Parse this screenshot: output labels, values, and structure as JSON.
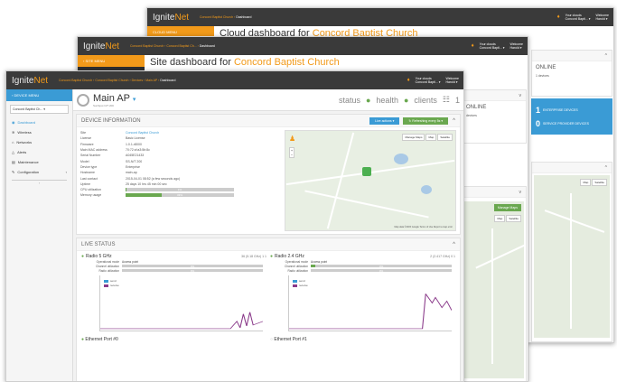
{
  "brand": {
    "name_prefix": "Ignite",
    "name_suffix": "Net"
  },
  "cloud_window": {
    "breadcrumb_link": "Concord Baptist Church",
    "breadcrumb_current": "Dashboard",
    "menu_title": "CLOUD MENU",
    "page_title_prefix": "Cloud dashboard for",
    "page_title_org": "Concord Baptist Church",
    "user_org_label": "Your clouds",
    "user_org": "Concord Bapti...",
    "welcome_label": "Welcome",
    "user_name": "Harold",
    "online_title": "ONLINE",
    "online_count": "1 devices",
    "enterprise_label": "ENTERPRISE DEVICES",
    "enterprise_count": "1",
    "service_label": "SERVICE PROVIDER DEVICES",
    "service_count": "0"
  },
  "site_window": {
    "breadcrumb_link": "Concord Baptist Church",
    "breadcrumb_mid": "Concord Baptist Ch...",
    "breadcrumb_current": "Dashboard",
    "menu_title": "SITE MENU",
    "page_title_prefix": "Site dashboard for",
    "page_title_org": "Concord Baptist Church",
    "online_title": "ONLINE",
    "online_sub": "devices",
    "manage_maps": "Manage Maps",
    "map_btn": "Map",
    "satellite_btn": "Satellite"
  },
  "device_window": {
    "breadcrumb": [
      "Concord Baptist Church",
      "Concord Baptist Church",
      "Devices",
      "Main AP",
      "Dashboard"
    ],
    "menu_title": "DEVICE MENU",
    "site_select": "Concord Baptist Ch...",
    "nav": [
      {
        "icon": "dashboard-icon",
        "glyph": "◉",
        "label": "Dashboard"
      },
      {
        "icon": "wireless-icon",
        "glyph": "≋",
        "label": "Wireless"
      },
      {
        "icon": "networks-icon",
        "glyph": "⌂",
        "label": "Networks"
      },
      {
        "icon": "alerts-icon",
        "glyph": "△",
        "label": "Alerts"
      },
      {
        "icon": "maintenance-icon",
        "glyph": "▤",
        "label": "Maintenance"
      },
      {
        "icon": "configuration-icon",
        "glyph": "✎",
        "label": "Configuration"
      }
    ],
    "device_name": "Main AP",
    "device_model": "SunSpot N/T 200",
    "status_label": "status",
    "health_label": "health",
    "clients_label": "clients",
    "clients_count": "1",
    "info_title": "DEVICE INFORMATION",
    "live_actions": "Live actions",
    "refreshing": "Refreshing every 5s",
    "info": [
      {
        "k": "Site",
        "v": "Concord Baptist Church",
        "link": true
      },
      {
        "k": "License",
        "v": "Basic License"
      },
      {
        "k": "Firmware",
        "v": "1.0.1-r8000"
      },
      {
        "k": "Main MAC address",
        "v": "70:72:cf:a3:5b:8c"
      },
      {
        "k": "Serial Number",
        "v": "A045E21433"
      },
      {
        "k": "Model",
        "v": "SS-N/T 200"
      },
      {
        "k": "Device type",
        "v": "Enterprise"
      },
      {
        "k": "Hostname",
        "v": "main-ap"
      },
      {
        "k": "Last contact",
        "v": "2015-04-01 08:52 (a few seconds ago)"
      },
      {
        "k": "Uptime",
        "v": "25 days 10 hrs 45 min 00 sec"
      }
    ],
    "cpu_label": "CPU utilization",
    "cpu_value": "1%",
    "cpu_percent": 1,
    "memory_label": "Memory usage",
    "memory_value": "33%",
    "memory_percent": 33,
    "map_manage": "Manage Maps",
    "map_btn": "Map",
    "satellite_btn": "Satellite",
    "map_footer": "Map data ©2015 Google   Terms of Use   Report a map error",
    "live_title": "LIVE STATUS",
    "radios": [
      {
        "name": "Radio 5 GHz",
        "meta": "36 (5.18 GHz)  1  1",
        "mode_label": "Operational mode",
        "mode": "Access point",
        "channel_label": "Channel utilization",
        "channel_value": "0%",
        "channel_percent": 0,
        "radio_label": "Radio utilization",
        "radio_value": "0%",
        "radio_percent": 0,
        "legend_send": "send",
        "legend_receive": "receive"
      },
      {
        "name": "Radio 2.4 GHz",
        "meta": "2 (2.417 GHz)  0  1",
        "mode_label": "Operational mode",
        "mode": "Access point",
        "channel_label": "Channel utilization",
        "channel_value": "3%",
        "channel_percent": 3,
        "radio_label": "Radio utilization",
        "radio_value": "0%",
        "radio_percent": 0,
        "legend_send": "send",
        "legend_receive": "receive"
      }
    ],
    "eth0": "Ethernet Port #0",
    "eth1": "Ethernet Port #1"
  },
  "colors": {
    "accent": "#f29a1a",
    "blue": "#3a9bd5",
    "green": "#6aa84f",
    "topbar": "#3a3a3a"
  }
}
